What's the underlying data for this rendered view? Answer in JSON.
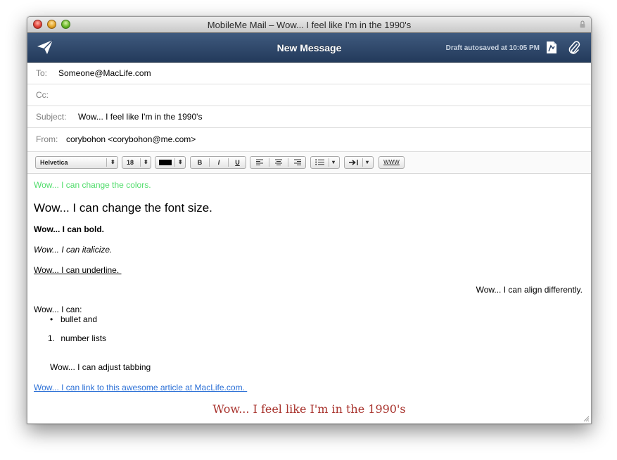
{
  "window": {
    "title": "MobileMe Mail – Wow... I feel like I'm in the 1990's"
  },
  "toolbar": {
    "title": "New Message",
    "autosave": "Draft autosaved at 10:05 PM",
    "icons": [
      "send-icon",
      "document-icon",
      "paperclip-icon"
    ]
  },
  "fields": {
    "to_label": "To:",
    "to_value": "Someone@MacLife.com",
    "cc_label": "Cc:",
    "cc_value": "",
    "subject_label": "Subject:",
    "subject_value": "Wow... I feel like I'm in the 1990's",
    "from_label": "From:",
    "from_value": "corybohon <corybohon@me.com>"
  },
  "format": {
    "font": "Helvetica",
    "size": "18",
    "color": "#000000",
    "bold": "B",
    "italic": "I",
    "underline": "U",
    "link": "WWW"
  },
  "body": {
    "colors": "Wow... I can change the colors.",
    "font_size": "Wow... I can change the font size.",
    "bold": "Wow... I can bold.",
    "italic": "Wow... I can italicize.",
    "underline": "Wow... I can underline. ",
    "align": "Wow... I can align differently.",
    "lists_intro": "Wow... I can:",
    "bullet_item": "bullet and",
    "number_marker": "1.",
    "number_item": "number lists",
    "tabbing": "Wow... I can adjust tabbing",
    "link": "Wow... I can link to this awesome article at MacLife.com. ",
    "closing": "Wow... I feel like I'm in the 1990's"
  },
  "colors": {
    "green_text": "#4fdc6a",
    "link_blue": "#2a6fd6",
    "closing_red": "#a8322c",
    "toolbar_top": "#3f5a7e",
    "toolbar_bottom": "#233a5b"
  }
}
